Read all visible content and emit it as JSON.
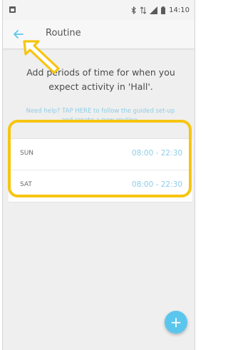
{
  "status_bar": {
    "time": "14:10",
    "icons": [
      "app-notification-icon",
      "bluetooth-icon",
      "mobile-data-icon",
      "signal-icon",
      "battery-icon"
    ]
  },
  "app_bar": {
    "title": "Routine",
    "back_icon": "back-arrow-icon"
  },
  "content": {
    "intro": "Add periods of time for when you expect activity in 'Hall'.",
    "help": "Need help? TAP HERE to follow the guided set-up and create a new routine."
  },
  "routines": [
    {
      "day": "SUN",
      "time": "08:00 - 22:30"
    },
    {
      "day": "SAT",
      "time": "08:00 - 22:30"
    }
  ],
  "fab": {
    "label": "+",
    "icon": "add-icon"
  },
  "colors": {
    "accent": "#5bc6ed",
    "link": "#8fcde6",
    "highlight": "#f7c511",
    "background": "#efefef"
  }
}
